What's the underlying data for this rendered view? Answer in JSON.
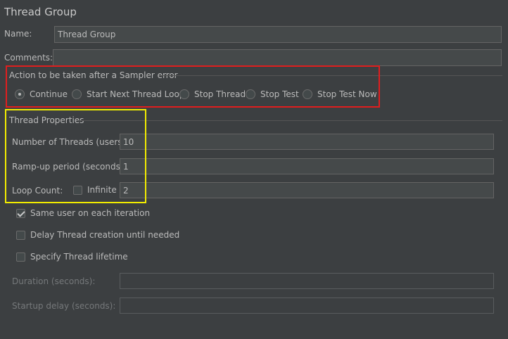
{
  "panel": {
    "title": "Thread Group"
  },
  "name_field": {
    "label": "Name:",
    "value": "Thread Group"
  },
  "comments_field": {
    "label": "Comments:",
    "value": ""
  },
  "sampler_error": {
    "title": "Action to be taken after a Sampler error",
    "options": [
      {
        "label": "Continue",
        "selected": true
      },
      {
        "label": "Start Next Thread Loop",
        "selected": false
      },
      {
        "label": "Stop Thread",
        "selected": false
      },
      {
        "label": "Stop Test",
        "selected": false
      },
      {
        "label": "Stop Test Now",
        "selected": false
      }
    ]
  },
  "thread_properties": {
    "title": "Thread Properties",
    "num_threads": {
      "label": "Number of Threads (users):",
      "value": "10"
    },
    "ramp_up": {
      "label": "Ramp-up period (seconds):",
      "value": "1"
    },
    "loop_count": {
      "label": "Loop Count:",
      "infinite_label": "Infinite",
      "infinite_checked": false,
      "value": "2"
    }
  },
  "options": {
    "same_user": {
      "label": "Same user on each iteration",
      "checked": true
    },
    "delay_creation": {
      "label": "Delay Thread creation until needed",
      "checked": false
    },
    "specify_lifetime": {
      "label": "Specify Thread lifetime",
      "checked": false
    }
  },
  "lifetime": {
    "duration": {
      "label": "Duration (seconds):",
      "value": ""
    },
    "startup_delay": {
      "label": "Startup delay (seconds):",
      "value": ""
    }
  },
  "highlight_colors": {
    "red": "#e01e1e",
    "yellow": "#f2ec00"
  }
}
